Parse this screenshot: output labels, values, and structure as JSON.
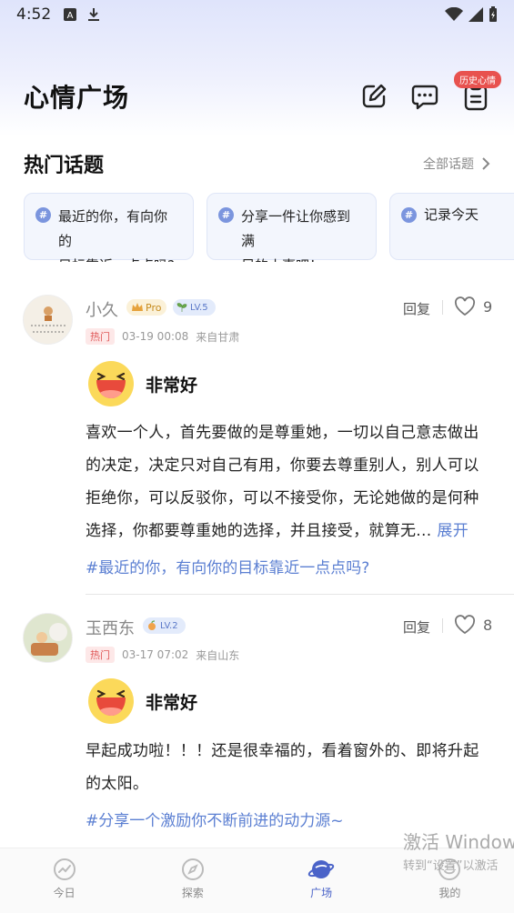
{
  "status_bar": {
    "time": "4:52"
  },
  "header": {
    "title": "心情广场",
    "history_badge": "历史心情"
  },
  "hot_topics": {
    "title": "热门话题",
    "see_all": "全部话题",
    "cards": [
      {
        "line1": "最近的你，有向你的",
        "line2": "目标靠近一点点吗?"
      },
      {
        "line1": "分享一件让你感到满",
        "line2": "足的小事吧！"
      },
      {
        "line1": "记录今天",
        "line2": ""
      }
    ]
  },
  "posts": [
    {
      "username": "小久",
      "pro_label": "Pro",
      "level": "LV.5",
      "hot_tag": "热门",
      "time": "03-19 00:08",
      "location": "来自甘肃",
      "reply": "回复",
      "likes": "9",
      "mood": "非常好",
      "body": "喜欢一个人，首先要做的是尊重她，一切以自己意志做出的决定，决定只对自己有用，你要去尊重别人，别人可以拒绝你，可以反驳你，可以不接受你，无论她做的是何种选择，你都要尊重她的选择，并且接受，就算无...",
      "expand": "展开",
      "topic": "#最近的你，有向你的目标靠近一点点吗?"
    },
    {
      "username": "玉西东",
      "level": "LV.2",
      "hot_tag": "热门",
      "time": "03-17 07:02",
      "location": "来自山东",
      "reply": "回复",
      "likes": "8",
      "mood": "非常好",
      "body": "早起成功啦！！！还是很幸福的，看着窗外的、即将升起的太阳。",
      "topic": "#分享一个激励你不断前进的动力源~"
    }
  ],
  "bottom_nav": [
    {
      "label": "今日",
      "icon": "chart-icon"
    },
    {
      "label": "探索",
      "icon": "compass-icon"
    },
    {
      "label": "广场",
      "icon": "planet-icon",
      "active": true
    },
    {
      "label": "我的",
      "icon": "smile-icon"
    }
  ],
  "watermark": {
    "line1": "激活 Window",
    "line2": "转到“设置”以激活"
  },
  "colors": {
    "accent": "#4a63c8",
    "hot": "#e05a5a",
    "topic_link": "#5b7fd2"
  }
}
